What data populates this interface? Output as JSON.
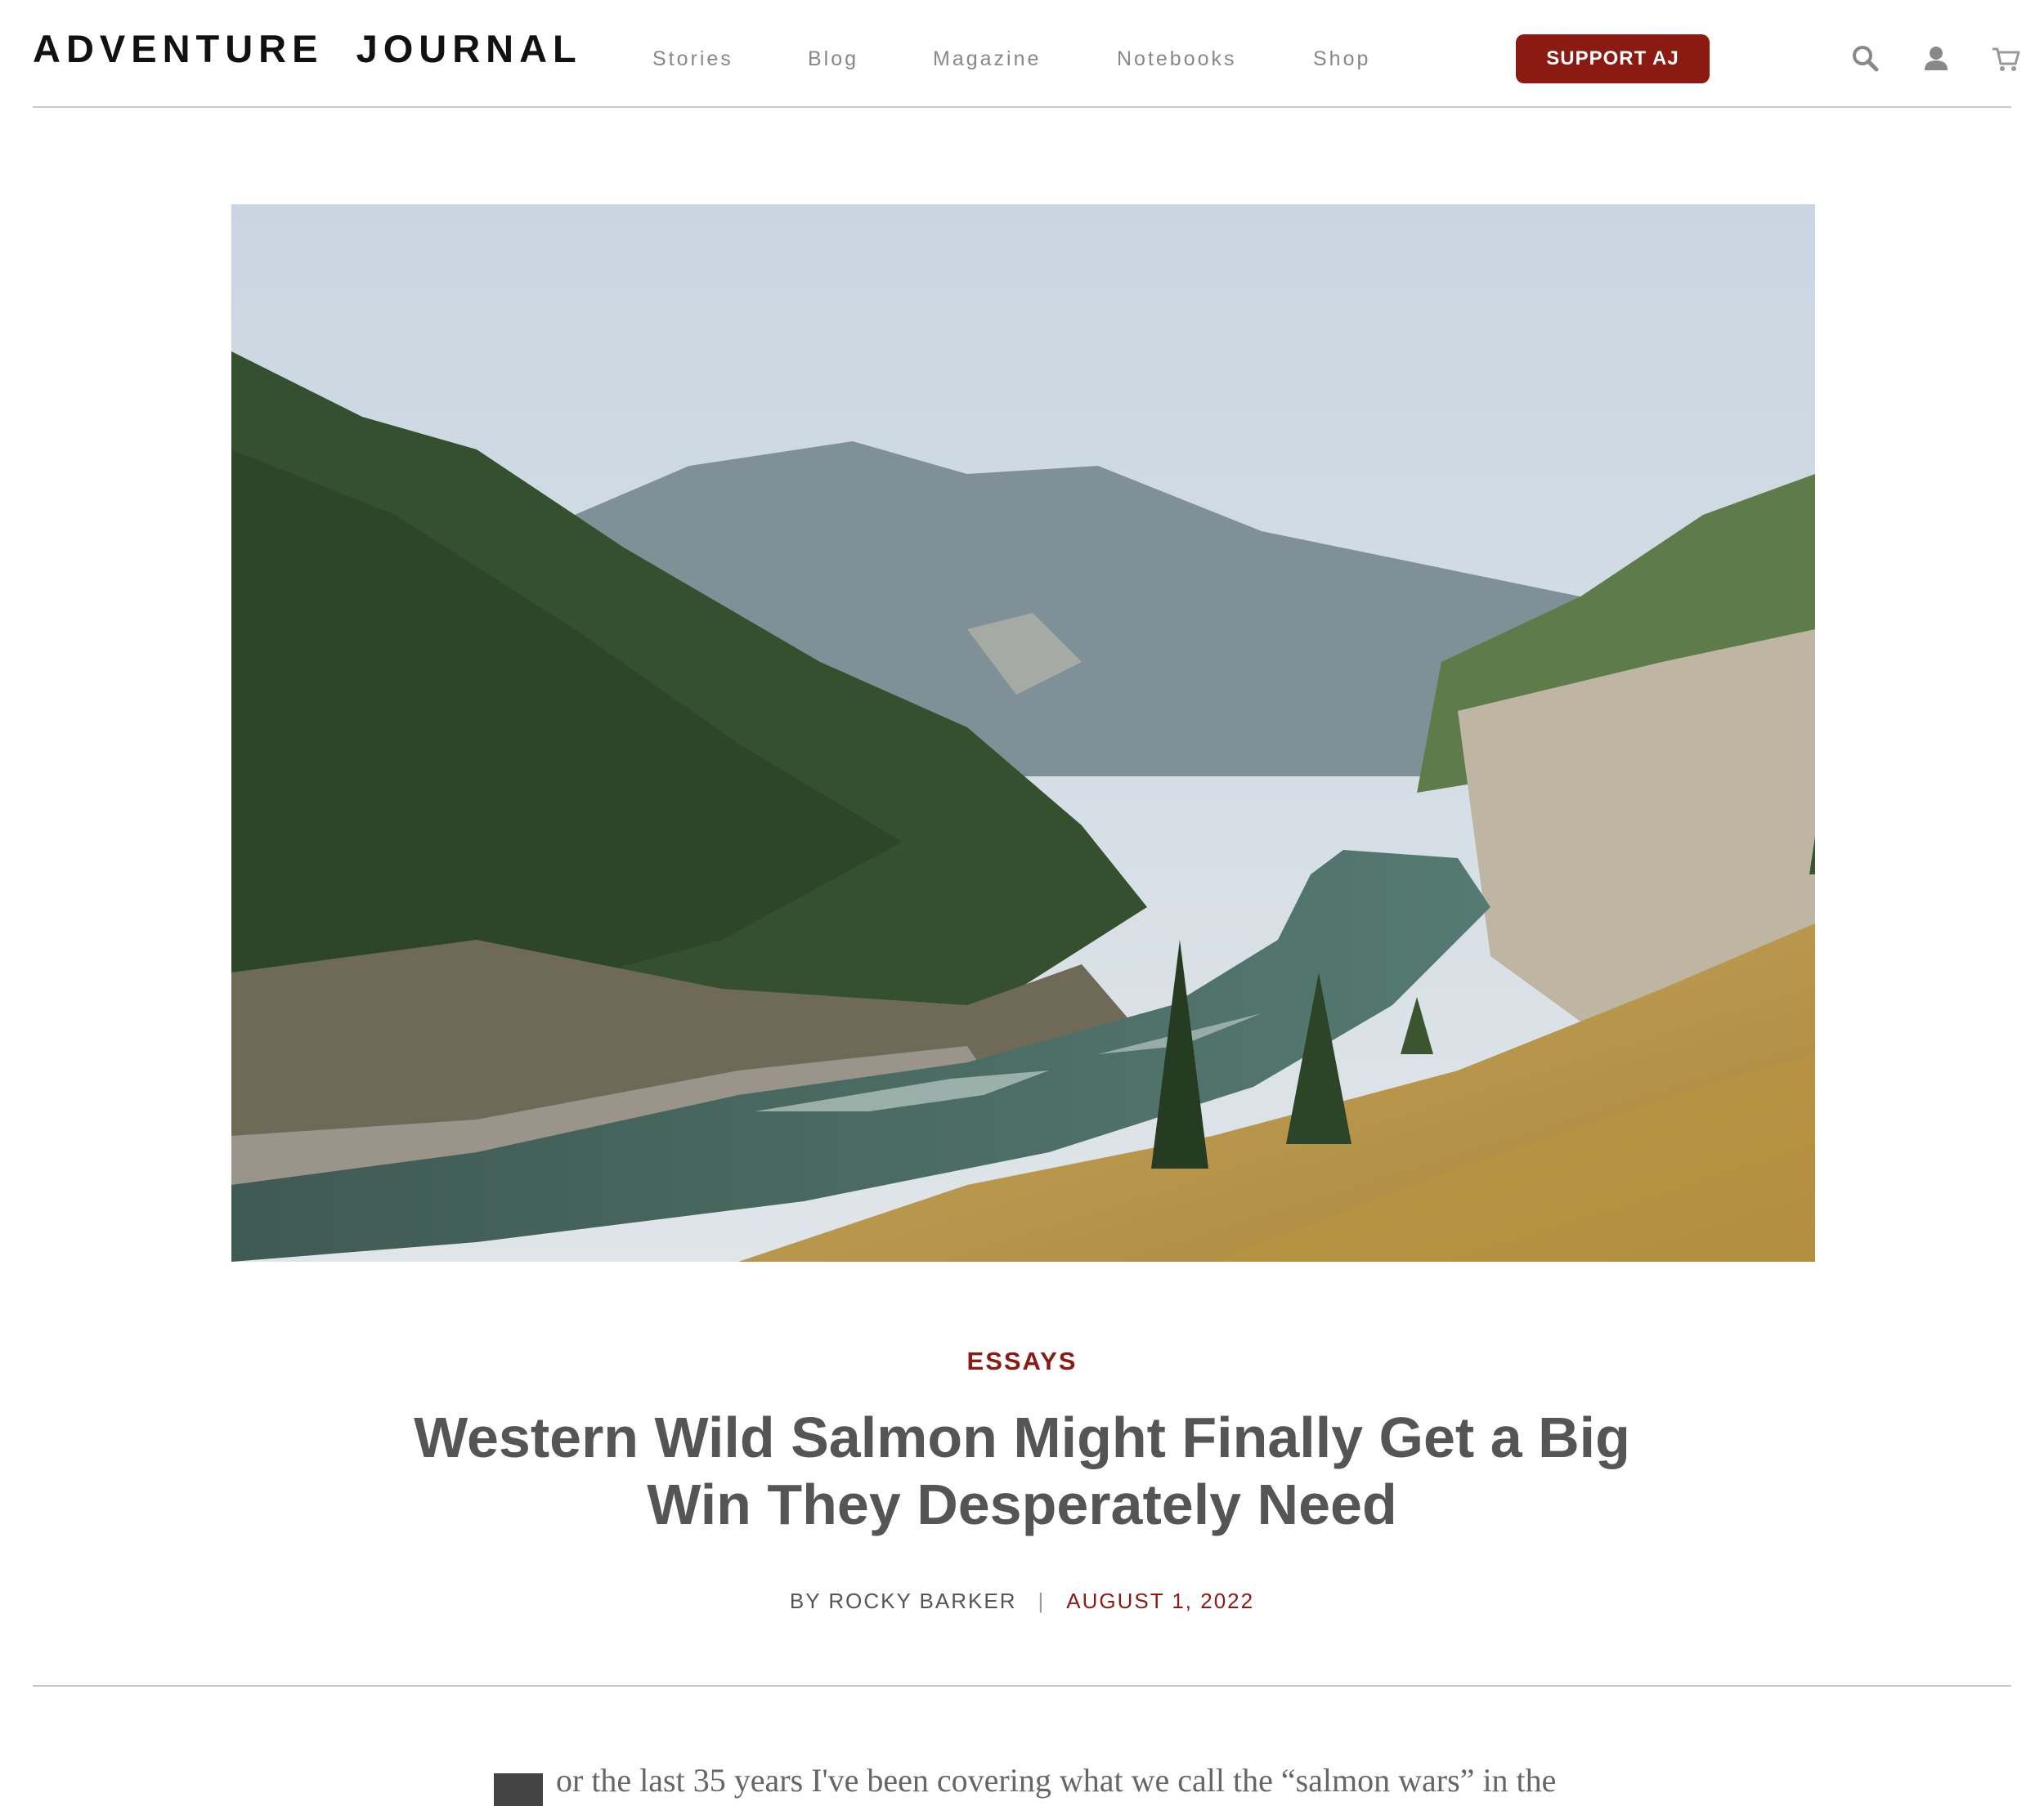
{
  "header": {
    "logo": "ADVENTURE  JOURNAL",
    "nav": [
      {
        "label": "Stories"
      },
      {
        "label": "Blog"
      },
      {
        "label": "Magazine"
      },
      {
        "label": "Notebooks"
      },
      {
        "label": "Shop"
      }
    ],
    "support_label": "SUPPORT AJ",
    "icons": [
      "search-icon",
      "user-icon",
      "cart-icon"
    ]
  },
  "article": {
    "category": "ESSAYS",
    "title": "Western Wild Salmon Might Finally Get a Big Win They Desperately Need",
    "byline_author": "BY ROCKY BARKER",
    "byline_separator": "|",
    "date": "AUGUST 1, 2022",
    "first_line": "or the last 35 years I've been covering what we call the “salmon wars” in the"
  },
  "colors": {
    "accent": "#8b1a13",
    "nav_text": "#888888",
    "title_text": "#555555"
  }
}
